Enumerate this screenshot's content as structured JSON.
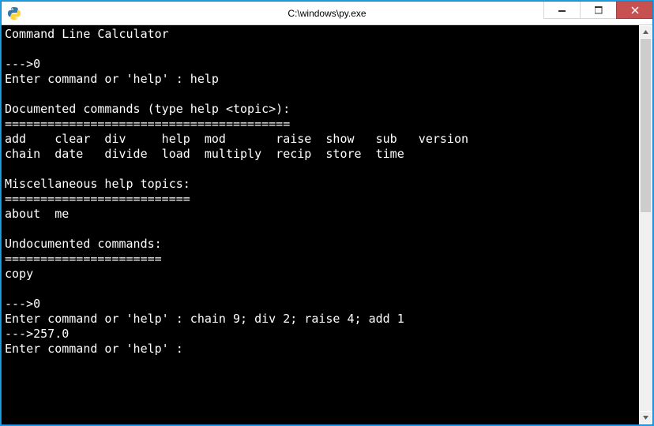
{
  "window": {
    "title": "C:\\windows\\py.exe",
    "icon": "python-icon"
  },
  "terminal": {
    "lines": [
      "Command Line Calculator",
      "",
      "--->0",
      "Enter command or 'help' : help",
      "",
      "Documented commands (type help <topic>):",
      "========================================",
      "add    clear  div     help  mod       raise  show   sub   version",
      "chain  date   divide  load  multiply  recip  store  time",
      "",
      "Miscellaneous help topics:",
      "==========================",
      "about  me",
      "",
      "Undocumented commands:",
      "======================",
      "copy",
      "",
      "--->0",
      "Enter command or 'help' : chain 9; div 2; raise 4; add 1",
      "--->257.0",
      "Enter command or 'help' :"
    ]
  },
  "help": {
    "documented_commands": [
      "add",
      "clear",
      "div",
      "help",
      "mod",
      "raise",
      "show",
      "sub",
      "version",
      "chain",
      "date",
      "divide",
      "load",
      "multiply",
      "recip",
      "store",
      "time"
    ],
    "misc_topics": [
      "about",
      "me"
    ],
    "undocumented": [
      "copy"
    ]
  },
  "session": {
    "prompts": [
      {
        "display": 0,
        "input": "help"
      },
      {
        "display": 0,
        "input": "chain 9; div 2; raise 4; add 1"
      },
      {
        "display": 257.0,
        "input": ""
      }
    ]
  },
  "colors": {
    "window_border": "#1883cc",
    "titlebar_bg": "#ffffff",
    "close_bg": "#c75050",
    "terminal_bg": "#000000",
    "terminal_fg": "#ffffff"
  }
}
